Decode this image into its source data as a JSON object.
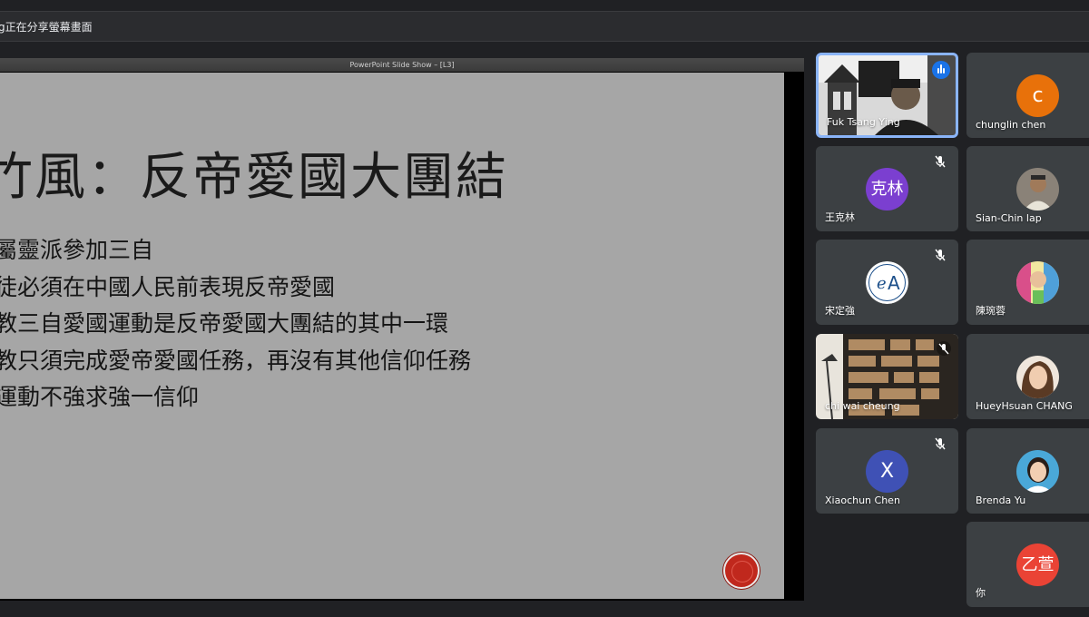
{
  "topbar": {
    "share_text": "g正在分享螢幕畫面"
  },
  "slideshow": {
    "window_title": "PowerPoint Slide Show – [L3]",
    "title": "竹風：反帝愛國大團結",
    "bullets": [
      "屬靈派參加三自",
      "徒必須在中國人民前表現反帝愛國",
      "教三自愛國運動是反帝愛國大團結的其中一環",
      "教只須完成愛帝愛國任務，再沒有其他信仰任務",
      "運動不強求強一信仰"
    ]
  },
  "participants": [
    {
      "name": "Fuk Tsang Ying",
      "type": "video",
      "speaking": true
    },
    {
      "name": "chunglin chen",
      "type": "initial",
      "initial": "c",
      "color": "#e8710a"
    },
    {
      "name": "王克林",
      "type": "initial",
      "initial": "克林",
      "color": "#7b3fd0",
      "muted": true
    },
    {
      "name": "Sian-Chin lap",
      "type": "photo"
    },
    {
      "name": "宋定強",
      "type": "logo",
      "muted": true
    },
    {
      "name": "陳琬蓉",
      "type": "photo"
    },
    {
      "name": "chi wai cheung",
      "type": "video",
      "muted": true
    },
    {
      "name": "HueyHsuan CHANG",
      "type": "photo"
    },
    {
      "name": "Xiaochun Chen",
      "type": "initial",
      "initial": "X",
      "color": "#3f51b5",
      "muted": true
    },
    {
      "name": "Brenda Yu",
      "type": "photo"
    },
    {
      "name": "你",
      "type": "initial",
      "initial": "乙萱",
      "color": "#ea4335"
    }
  ]
}
